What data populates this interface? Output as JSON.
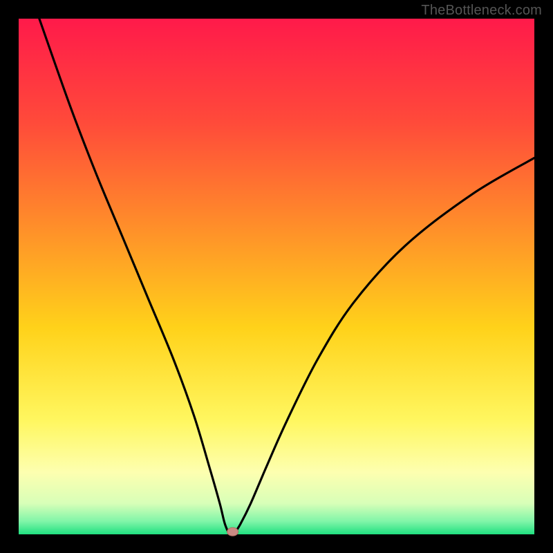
{
  "watermark": "TheBottleneck.com",
  "chart_data": {
    "type": "line",
    "title": "",
    "xlabel": "",
    "ylabel": "",
    "xlim": [
      0,
      100
    ],
    "ylim": [
      0,
      100
    ],
    "series": [
      {
        "name": "curve",
        "x": [
          4,
          10,
          15,
          20,
          25,
          30,
          34,
          37,
          39,
          40,
          41,
          42,
          43,
          45,
          48,
          52,
          58,
          65,
          75,
          88,
          100
        ],
        "values": [
          100,
          83,
          70,
          58,
          46,
          34,
          23,
          13,
          6,
          2,
          0,
          0.5,
          2,
          6,
          13,
          22,
          34,
          45,
          56,
          66,
          73
        ]
      }
    ],
    "marker": {
      "x": 41.5,
      "y": 0.5,
      "color_fill": "#c98a83",
      "color_stroke": "#b56a5f"
    },
    "gradient_stops": [
      {
        "offset": 0.0,
        "color": "#ff1a4a"
      },
      {
        "offset": 0.2,
        "color": "#ff4a3a"
      },
      {
        "offset": 0.4,
        "color": "#ff8d2a"
      },
      {
        "offset": 0.6,
        "color": "#ffd21a"
      },
      {
        "offset": 0.78,
        "color": "#fff760"
      },
      {
        "offset": 0.88,
        "color": "#fdffb0"
      },
      {
        "offset": 0.94,
        "color": "#d8ffb8"
      },
      {
        "offset": 0.975,
        "color": "#80f5a8"
      },
      {
        "offset": 1.0,
        "color": "#20e080"
      }
    ],
    "frame": {
      "outer": 800,
      "inset": 27
    }
  }
}
